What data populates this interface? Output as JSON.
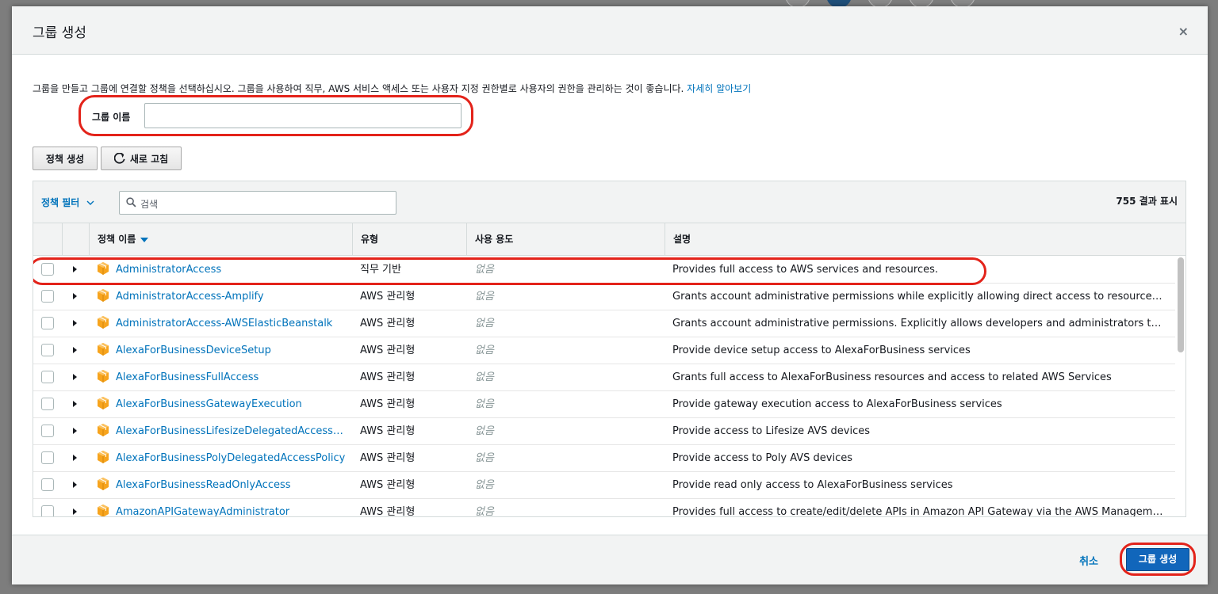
{
  "modal": {
    "title": "그룹 생성",
    "close_icon": "×"
  },
  "intro": {
    "text": "그룹을 만들고 그룹에 연결할 정책을 선택하십시오. 그룹을 사용하여 직무, AWS 서비스 액세스 또는 사용자 지정 권한별로 사용자의 권한을 관리하는 것이 좋습니다.",
    "learn_more": "자세히 알아보기"
  },
  "group_name": {
    "label": "그룹 이름",
    "value": ""
  },
  "toolbar": {
    "create_policy": "정책 생성",
    "refresh": "새로 고침"
  },
  "table": {
    "filter_label": "정책 필터",
    "search_placeholder": "검색",
    "result_count": "755 결과 표시",
    "columns": {
      "name": "정책 이름",
      "type": "유형",
      "usage": "사용 용도",
      "description": "설명"
    },
    "rows": [
      {
        "name": "AdministratorAccess",
        "type": "직무 기반",
        "usage": "없음",
        "description": "Provides full access to AWS services and resources."
      },
      {
        "name": "AdministratorAccess-Amplify",
        "type": "AWS 관리형",
        "usage": "없음",
        "description": "Grants account administrative permissions while explicitly allowing direct access to resources needed by Amplify applications."
      },
      {
        "name": "AdministratorAccess-AWSElasticBeanstalk",
        "type": "AWS 관리형",
        "usage": "없음",
        "description": "Grants account administrative permissions. Explicitly allows developers and administrators to gain direct access to resources they need to manage AWS Elastic Beanstalk applications."
      },
      {
        "name": "AlexaForBusinessDeviceSetup",
        "type": "AWS 관리형",
        "usage": "없음",
        "description": "Provide device setup access to AlexaForBusiness services"
      },
      {
        "name": "AlexaForBusinessFullAccess",
        "type": "AWS 관리형",
        "usage": "없음",
        "description": "Grants full access to AlexaForBusiness resources and access to related AWS Services"
      },
      {
        "name": "AlexaForBusinessGatewayExecution",
        "type": "AWS 관리형",
        "usage": "없음",
        "description": "Provide gateway execution access to AlexaForBusiness services"
      },
      {
        "name": "AlexaForBusinessLifesizeDelegatedAccessPolicy",
        "type": "AWS 관리형",
        "usage": "없음",
        "description": "Provide access to Lifesize AVS devices"
      },
      {
        "name": "AlexaForBusinessPolyDelegatedAccessPolicy",
        "type": "AWS 관리형",
        "usage": "없음",
        "description": "Provide access to Poly AVS devices"
      },
      {
        "name": "AlexaForBusinessReadOnlyAccess",
        "type": "AWS 관리형",
        "usage": "없음",
        "description": "Provide read only access to AlexaForBusiness services"
      },
      {
        "name": "AmazonAPIGatewayAdministrator",
        "type": "AWS 관리형",
        "usage": "없음",
        "description": "Provides full access to create/edit/delete APIs in Amazon API Gateway via the AWS Management Console."
      }
    ]
  },
  "footer": {
    "cancel": "취소",
    "submit": "그룹 생성"
  },
  "colors": {
    "link": "#0073bb",
    "highlight": "#e3231a",
    "primary_button": "#1166bb",
    "package_icon": "#f7a41d"
  },
  "icons": {
    "close": "close-icon",
    "refresh": "refresh-icon",
    "search": "search-icon",
    "chevron": "chevron-down-icon",
    "sort": "sort-descending-icon",
    "expand": "expand-caret-icon",
    "policy": "package-icon"
  }
}
